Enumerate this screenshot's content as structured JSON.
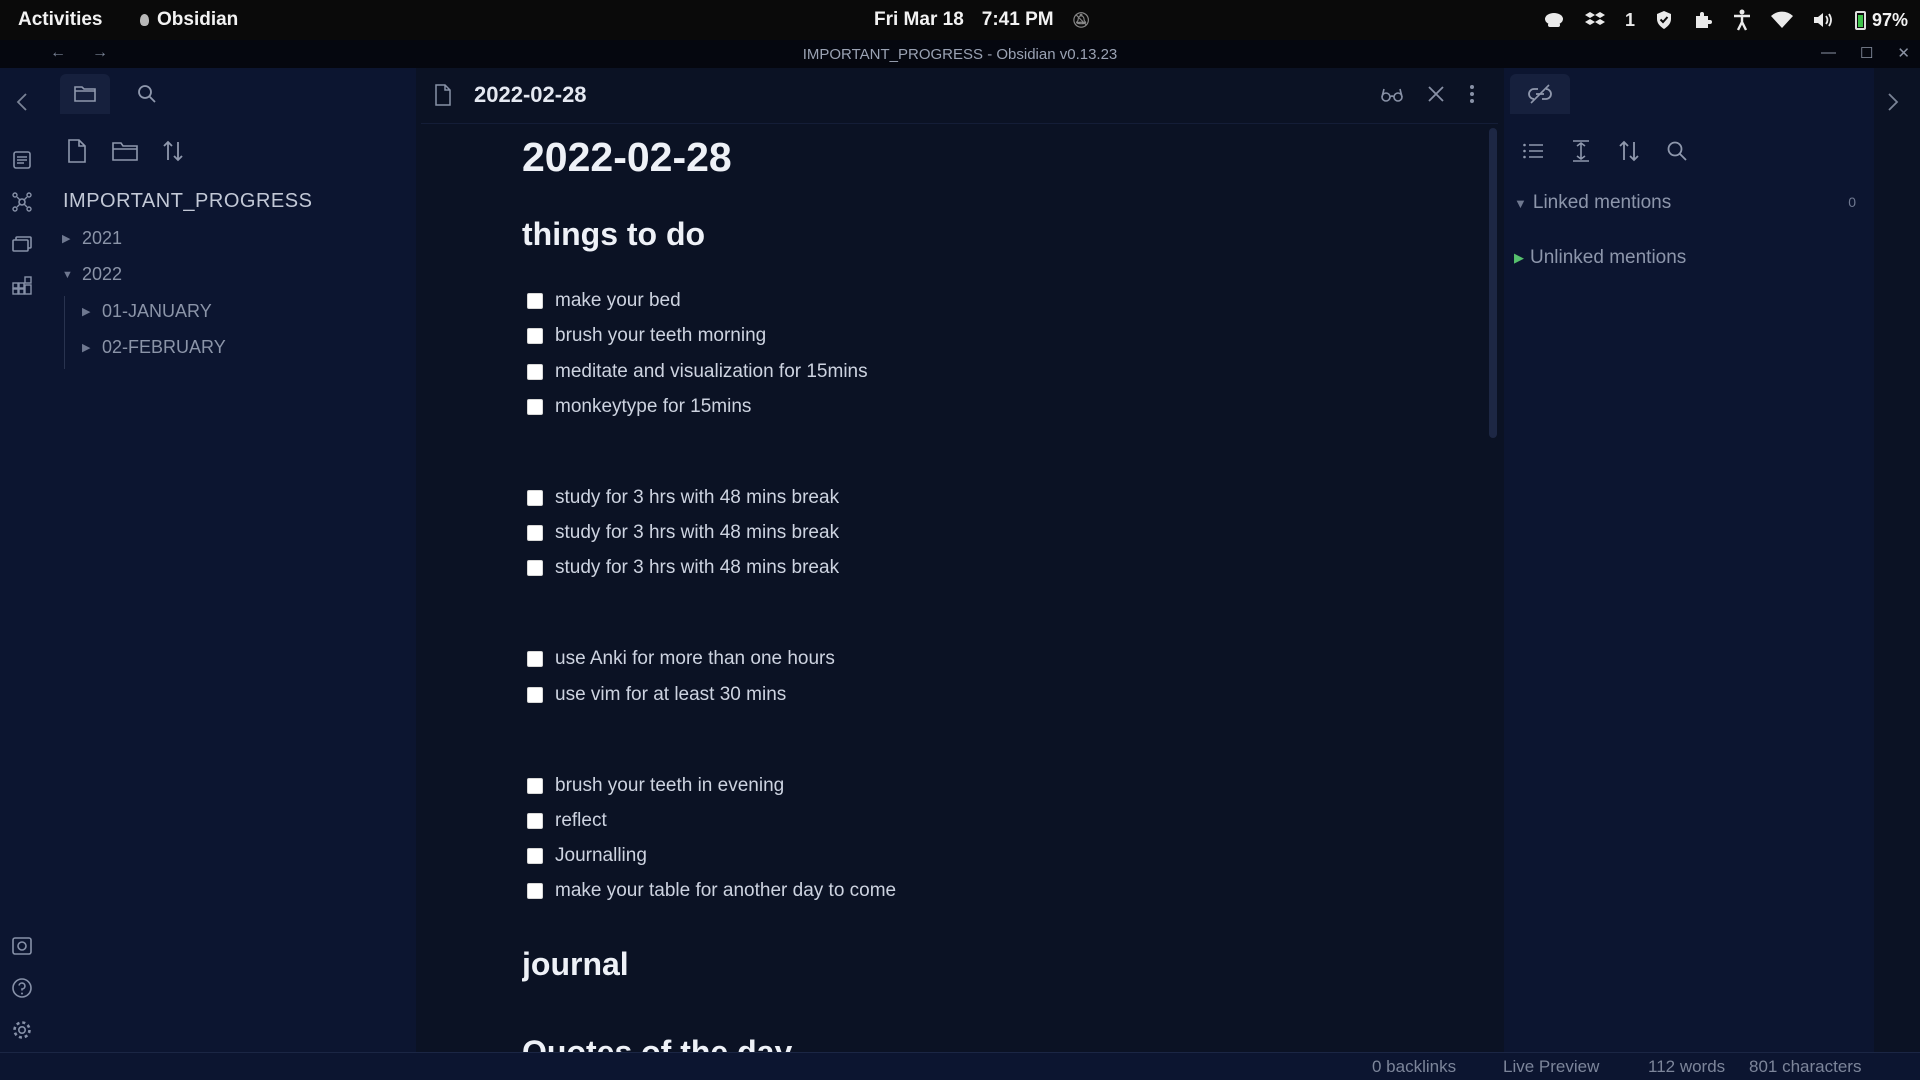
{
  "topbar": {
    "activities": "Activities",
    "app_name": "Obsidian",
    "date": "Fri Mar 18",
    "time": "7:41 PM",
    "tray_count": "1",
    "battery": "97%"
  },
  "window": {
    "title": "IMPORTANT_PROGRESS - Obsidian v0.13.23",
    "back_glyph": "←",
    "forward_glyph": "→",
    "minimize": "—",
    "maximize": "☐",
    "close": "✕"
  },
  "file_explorer": {
    "vault_name": "IMPORTANT_PROGRESS",
    "tree": [
      {
        "label": "2021",
        "expanded": false,
        "level": 0
      },
      {
        "label": "2022",
        "expanded": true,
        "level": 0
      },
      {
        "label": "01-JANUARY",
        "expanded": false,
        "level": 1
      },
      {
        "label": "02-FEBRUARY",
        "expanded": false,
        "level": 1
      }
    ]
  },
  "editor": {
    "tab_title": "2022-02-28",
    "heading": "2022-02-28",
    "section_todo": "things to do",
    "tasks": [
      "make your bed",
      "brush your teeth morning",
      "meditate and visualization for 15mins",
      "monkeytype for 15mins",
      "study for 3 hrs with 48 mins break",
      "study for 3 hrs with 48 mins break",
      "study for 3 hrs with 48 mins break",
      "use Anki for more than one hours",
      "use vim for at least 30 mins",
      "brush your teeth in evening",
      "reflect",
      "Journalling",
      "make your table for another day to come"
    ],
    "section_journal": "journal",
    "section_quotes_partial": "Quotes of the day"
  },
  "backlinks": {
    "linked": "Linked mentions",
    "linked_count": "0",
    "unlinked": "Unlinked mentions"
  },
  "statusbar": {
    "backlinks": "0 backlinks",
    "mode": "Live Preview",
    "words": "112 words",
    "characters": "801 characters"
  },
  "colors": {
    "background": "#0b1224",
    "sidebar": "#0c1530",
    "accent_green": "#56c06d"
  }
}
